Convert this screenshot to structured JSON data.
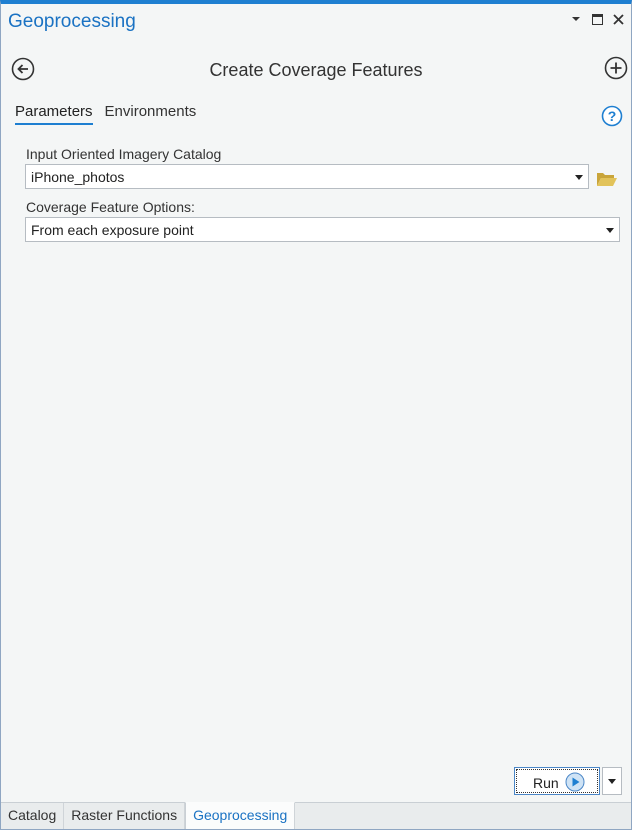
{
  "pane": {
    "title": "Geoprocessing"
  },
  "tool": {
    "title": "Create Coverage Features"
  },
  "tabs": [
    {
      "label": "Parameters",
      "active": true
    },
    {
      "label": "Environments",
      "active": false
    }
  ],
  "params": [
    {
      "label": "Input Oriented Imagery Catalog",
      "value": "iPhone_photos"
    },
    {
      "label": "Coverage Feature Options:",
      "value": "From each exposure point"
    }
  ],
  "run": {
    "label": "Run"
  },
  "bottom_tabs": [
    {
      "label": "Catalog",
      "active": false
    },
    {
      "label": "Raster Functions",
      "active": false
    },
    {
      "label": "Geoprocessing",
      "active": true
    }
  ],
  "colors": {
    "accent": "#1e7fd1",
    "title_blue": "#1a72c3",
    "folder": "#d8b74a"
  },
  "icons": [
    "chevron-down-icon",
    "maximize-icon",
    "close-icon",
    "back-arrow-icon",
    "add-circle-icon",
    "help-icon",
    "folder-open-icon",
    "play-icon"
  ]
}
